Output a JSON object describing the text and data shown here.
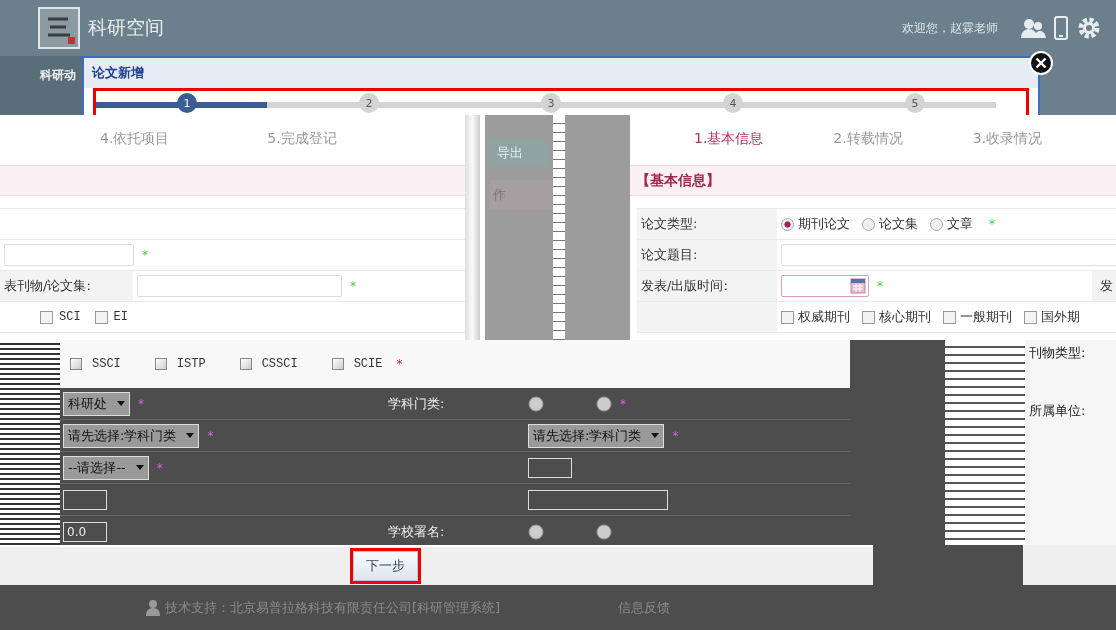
{
  "header": {
    "title": "科研空间",
    "welcome": "欢迎您，赵霖老师"
  },
  "nav": {
    "label": "科研动"
  },
  "dialog": {
    "title": "论文新增",
    "progress": {
      "level": 0.19
    },
    "steps": [
      {
        "label": "1",
        "selected": true
      },
      {
        "label": "2",
        "selected": false
      },
      {
        "label": "3",
        "selected": false
      },
      {
        "label": "4",
        "selected": false
      },
      {
        "label": "5",
        "selected": false
      }
    ]
  },
  "left_panel": {
    "tabs": [
      {
        "label": "4.依托项目",
        "selected": false
      },
      {
        "label": "5.完成登记",
        "selected": false
      }
    ],
    "fields": [
      {
        "mark": "*"
      },
      {
        "label": "表刊物/论文集:",
        "mark": "*"
      }
    ],
    "checkboxes": [
      {
        "label": "SCI",
        "checked": false
      },
      {
        "label": "EI",
        "checked": false
      }
    ]
  },
  "middle_panel": {
    "button": "导出",
    "text": "作"
  },
  "right_panel": {
    "tabs": [
      {
        "label": "1.基本信息",
        "selected": true
      },
      {
        "label": "2.转载情况",
        "selected": false
      },
      {
        "label": "3.收录情况",
        "selected": false
      }
    ],
    "section_title": "【基本信息】",
    "rows": [
      {
        "kind": "radio",
        "label": "论文类型:",
        "mark": "*",
        "options": [
          {
            "label": "期刊论文",
            "selected": true
          },
          {
            "label": "论文集",
            "selected": false
          },
          {
            "label": "文章",
            "selected": false
          }
        ]
      },
      {
        "kind": "text",
        "label": "论文题目:"
      },
      {
        "kind": "date",
        "label": "发表/出版时间:",
        "mark": "*",
        "side_label": "发"
      },
      {
        "kind": "checks",
        "options": [
          {
            "label": "权威期刊",
            "checked": false
          },
          {
            "label": "核心期刊",
            "checked": false
          },
          {
            "label": "一般期刊",
            "checked": false
          },
          {
            "label": "国外期",
            "checked": false
          }
        ]
      }
    ]
  },
  "indexing": {
    "mark": "*",
    "options": [
      {
        "label": "SSCI",
        "checked": false
      },
      {
        "label": "ISTP",
        "checked": false
      },
      {
        "label": "CSSCI",
        "checked": false
      },
      {
        "label": "SCIE",
        "checked": false
      }
    ]
  },
  "form": {
    "rows": [
      [
        {
          "kind": "select",
          "value": "科研处",
          "mark": "*"
        },
        {
          "kind": "label",
          "text": "学科门类:"
        },
        {
          "kind": "icons",
          "mark": "*"
        }
      ],
      [
        {
          "kind": "select",
          "value": "请先选择:学科门类",
          "mark": "*"
        },
        {
          "kind": "empty"
        },
        {
          "kind": "select",
          "value": "请先选择:学科门类",
          "mark": "*"
        }
      ],
      [
        {
          "kind": "select",
          "value": "--请选择--",
          "mark": "*"
        },
        {
          "kind": "empty"
        },
        {
          "kind": "input"
        }
      ],
      [
        {
          "kind": "input"
        },
        {
          "kind": "empty"
        },
        {
          "kind": "input",
          "wide": true
        }
      ],
      [
        {
          "kind": "input",
          "value": "0.0"
        },
        {
          "kind": "label",
          "text": "学校署名:"
        },
        {
          "kind": "icons"
        }
      ]
    ]
  },
  "side": {
    "labels": [
      "刊物类型:",
      "所属单位:"
    ]
  },
  "next_button": "下一步",
  "footer": {
    "support": "技术支持：北京易普拉格科技有限责任公司[科研管理系统]",
    "feedback": "信息反馈"
  }
}
